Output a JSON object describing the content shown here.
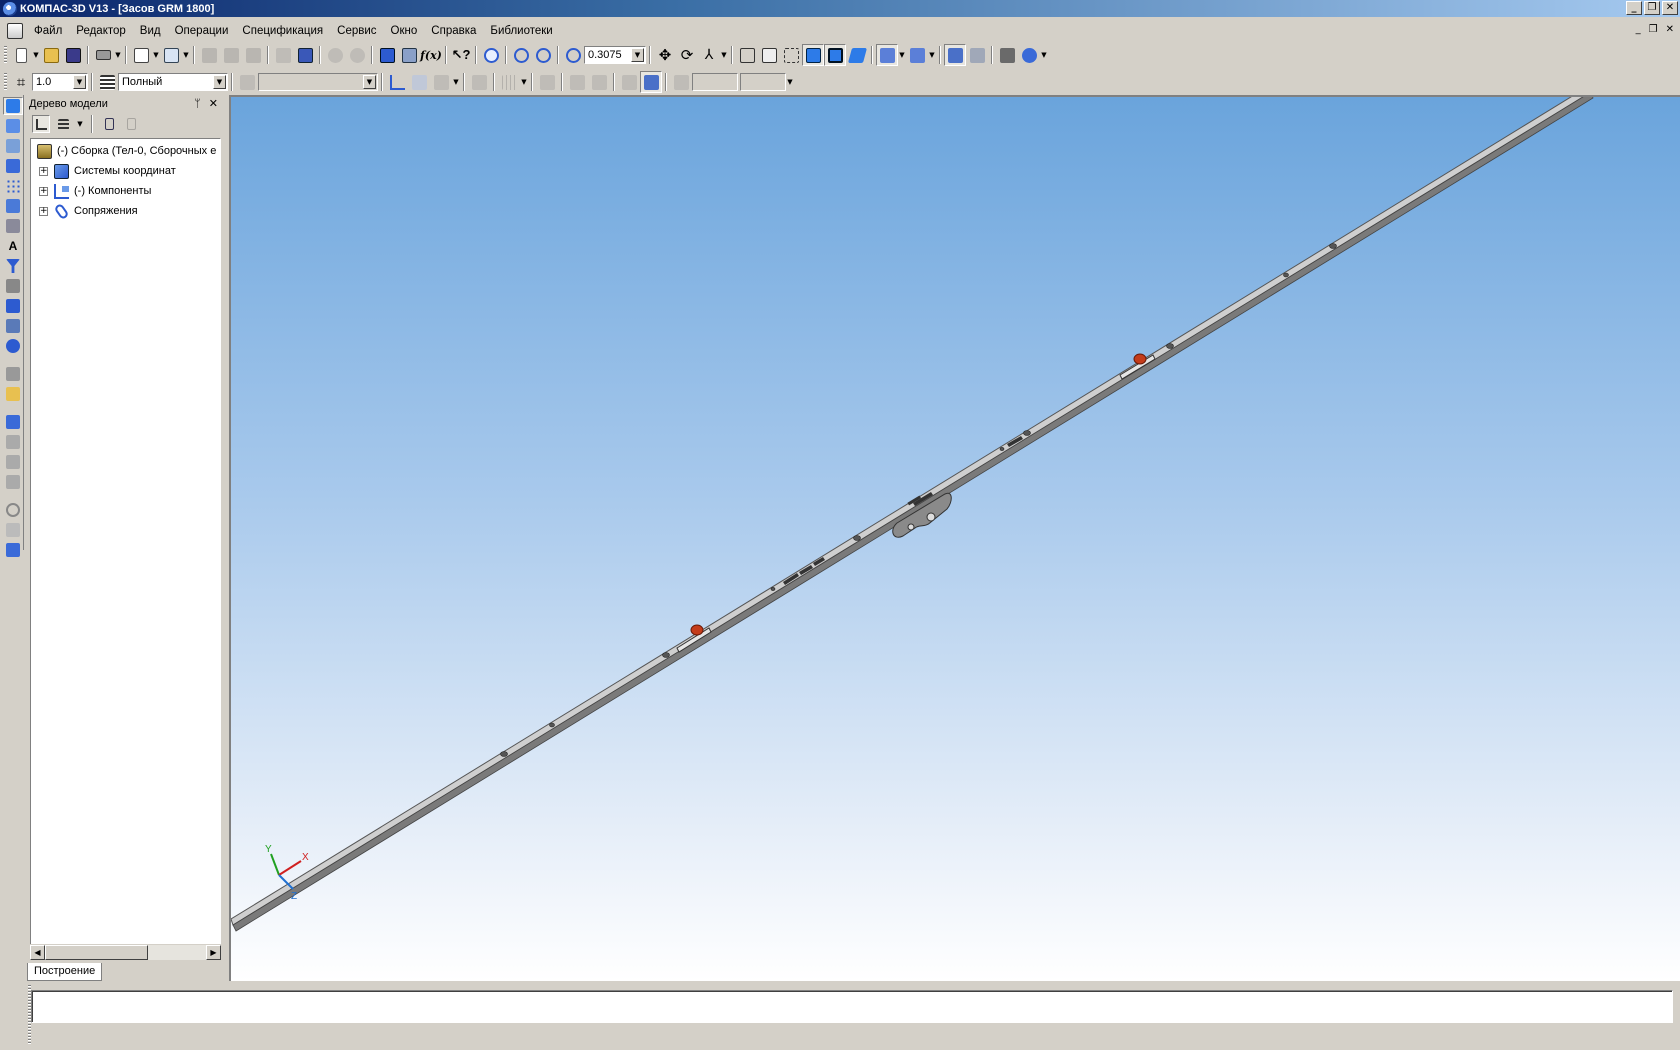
{
  "window": {
    "title": "КОМПАС-3D V13 - [Засов GRM 1800]"
  },
  "menu": [
    "Файл",
    "Редактор",
    "Вид",
    "Операции",
    "Спецификация",
    "Сервис",
    "Окно",
    "Справка",
    "Библиотеки"
  ],
  "toolbar": {
    "zoom_value": "0.3075",
    "step_value": "1.0",
    "style_value": "Полный"
  },
  "tree": {
    "title": "Дерево модели",
    "root": "(-) Сборка (Тел-0, Сборочных е",
    "items": [
      "Системы координат",
      "(-) Компоненты",
      "Сопряжения"
    ],
    "tab": "Построение"
  },
  "viewport": {
    "axes": {
      "x": "X",
      "y": "Y",
      "z": "Z"
    },
    "colors": {
      "bar": "#d2d2d2",
      "bar_edge": "#4a4a4a",
      "stud": "#c43c1a",
      "axis_x": "#d02020",
      "axis_y": "#20a020",
      "axis_z": "#2070d0"
    }
  },
  "icons": {
    "title": "kompas-logo-icon",
    "doc": "assembly-document-icon"
  }
}
